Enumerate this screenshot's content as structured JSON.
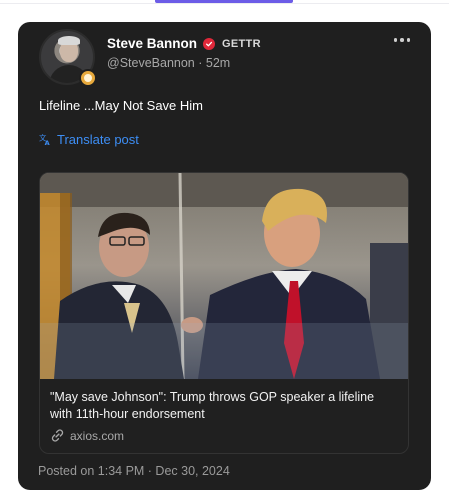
{
  "post": {
    "author_name": "Steve Bannon",
    "platform_badge": "GETTR",
    "handle": "@SteveBannon",
    "time_ago": "52m",
    "text": "Lifeline ...May Not Save Him",
    "translate_label": "Translate post",
    "posted_on": "Posted on 1:34 PM · Dec 30, 2024"
  },
  "link_preview": {
    "title": "\"May save Johnson\": Trump throws GOP speaker a lifeline with 11th-hour endorsement",
    "domain": "axios.com"
  },
  "icons": {
    "more": "more-horizontal-icon",
    "verified": "verified-badge-icon",
    "translate": "translate-icon",
    "link": "link-icon"
  },
  "colors": {
    "card_background": "#1f1f1f",
    "accent_blue": "#3d8ef5",
    "verified_red": "#e0283a",
    "top_accent": "#6c5ce7"
  }
}
